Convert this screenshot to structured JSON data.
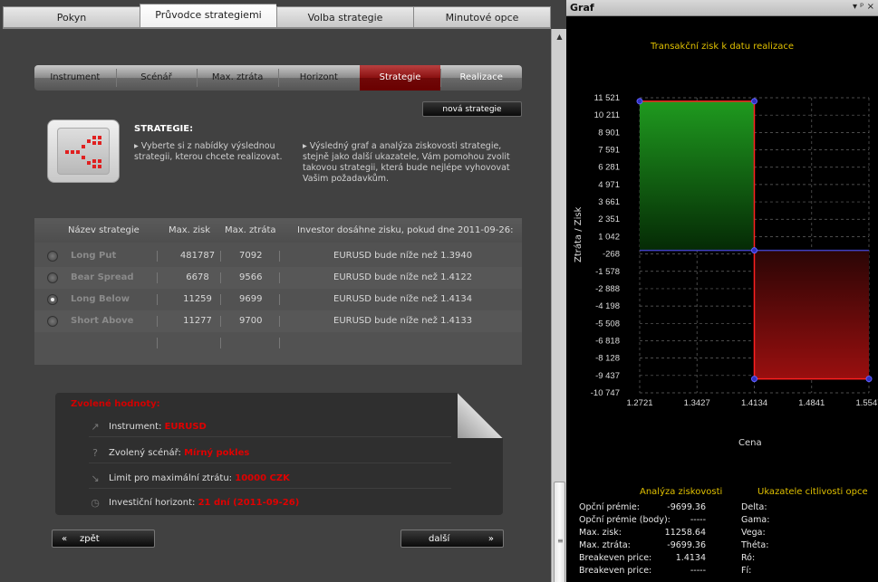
{
  "tabs": [
    "Pokyn",
    "Průvodce strategiemi",
    "Volba strategie",
    "Minutové opce"
  ],
  "steps": [
    "Instrument",
    "Scénář",
    "Max. ztráta",
    "Horizont",
    "Strategie",
    "Realizace"
  ],
  "new_strategy_label": "nová strategie",
  "strategy_title": "STRATEGIE:",
  "info1": "Vyberte si z nabídky výslednou strategii, kterou chcete realizovat.",
  "info2": "Výsledný graf a analýza ziskovosti strategie, stejně jako další ukazatele, Vám pomohou zvolit takovou strategii, která bude nejlépe vyhovovat Vašim požadavkům.",
  "table": {
    "headers": [
      "Název strategie",
      "Max. zisk",
      "Max. ztráta",
      "Investor dosáhne zisku, pokud dne 2011-09-26:"
    ],
    "rows": [
      {
        "name": "Long Put",
        "max_gain": "481787",
        "max_loss": "7092",
        "condition": "EURUSD bude níže než 1.3940"
      },
      {
        "name": "Bear Spread",
        "max_gain": "6678",
        "max_loss": "9566",
        "condition": "EURUSD bude níže než 1.4122"
      },
      {
        "name": "Long Below",
        "max_gain": "11259",
        "max_loss": "9699",
        "condition": "EURUSD bude níže než 1.4134"
      },
      {
        "name": "Short Above",
        "max_gain": "11277",
        "max_loss": "9700",
        "condition": "EURUSD bude níže než 1.4133"
      }
    ],
    "selected": 2
  },
  "selected_values": {
    "title": "Zvolené hodnoty:",
    "instrument_label": "Instrument:",
    "instrument_value": "EURUSD",
    "scenario_label": "Zvolený scénář:",
    "scenario_value": "Mírný pokles",
    "limit_label": "Limit pro maximální ztrátu:",
    "limit_value": "10000 CZK",
    "horizon_label": "Investiční horizont:",
    "horizon_value": "21 dní (2011-09-26)"
  },
  "back_label": "zpět",
  "next_label": "další",
  "back_arrow": "«",
  "next_arrow": "»",
  "graf_title": "Graf",
  "graf_controls": "▾ ᵖ ×",
  "analysis": {
    "title": "Analýza ziskovosti",
    "sens_title": "Ukazatele citlivosti opce",
    "rows": [
      {
        "label": "Opční prémie:",
        "value": "-9699.36",
        "sens": "Delta:"
      },
      {
        "label": "Opční prémie (body):",
        "value": "-----",
        "sens": "Gama:"
      },
      {
        "label": "Max. zisk:",
        "value": "11258.64",
        "sens": "Vega:"
      },
      {
        "label": "Max. ztráta:",
        "value": "-9699.36",
        "sens": "Théta:"
      },
      {
        "label": "Breakeven price:",
        "value": "1.4134",
        "sens": "Ró:"
      },
      {
        "label": "Breakeven price:",
        "value": "-----",
        "sens": "Fí:"
      }
    ]
  },
  "chart_data": {
    "type": "area",
    "title": "Transakční zisk k datu realizace",
    "xlabel": "Cena",
    "ylabel": "Ztráta / Zisk",
    "x_ticks": [
      "1.2721",
      "1.3427",
      "1.4134",
      "1.4841",
      "1.5547"
    ],
    "y_ticks": [
      "11 521",
      "10 211",
      "8 901",
      "7 591",
      "6 281",
      "4 971",
      "3 661",
      "2 351",
      "1 042",
      "-268",
      "-1 578",
      "-2 888",
      "-4 198",
      "-5 508",
      "-6 818",
      "-8 128",
      "-9 437",
      "-10 747"
    ],
    "xlim": [
      1.2721,
      1.5547
    ],
    "ylim": [
      -10747,
      11521
    ],
    "series": [
      {
        "x": [
          1.2721,
          1.4134,
          1.4134,
          1.5547
        ],
        "y": [
          11259,
          11259,
          -9699,
          -9699
        ]
      }
    ],
    "colors": {
      "gain": "#1f9a1f",
      "loss": "#9a0f0f",
      "line": "#ff2020",
      "zero_line": "#4040c0",
      "title": "#e0c000"
    }
  }
}
